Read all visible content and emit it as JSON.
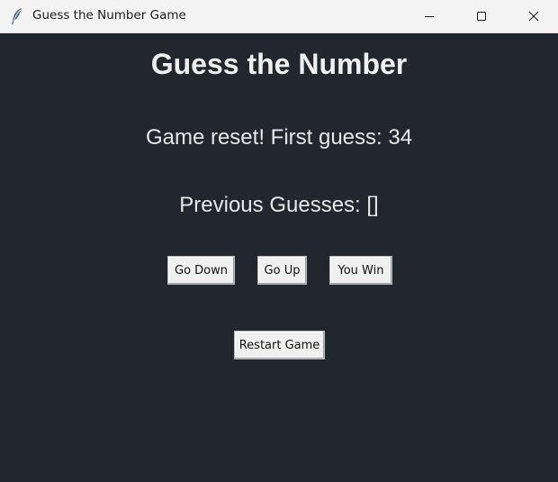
{
  "window": {
    "title": "Guess the Number Game",
    "icon": "feather-icon",
    "controls": [
      "minimize-icon",
      "maximize-icon",
      "close-icon"
    ]
  },
  "game": {
    "heading": "Guess the Number",
    "status": "Game reset! First guess: 34",
    "history": "Previous Guesses: []"
  },
  "buttons": {
    "go_down": "Go Down",
    "go_up": "Go Up",
    "you_win": "You Win",
    "restart": "Restart Game"
  },
  "colors": {
    "background": "#22272f",
    "text": "#f0f0f0",
    "titlebar": "#f3f3f3"
  }
}
